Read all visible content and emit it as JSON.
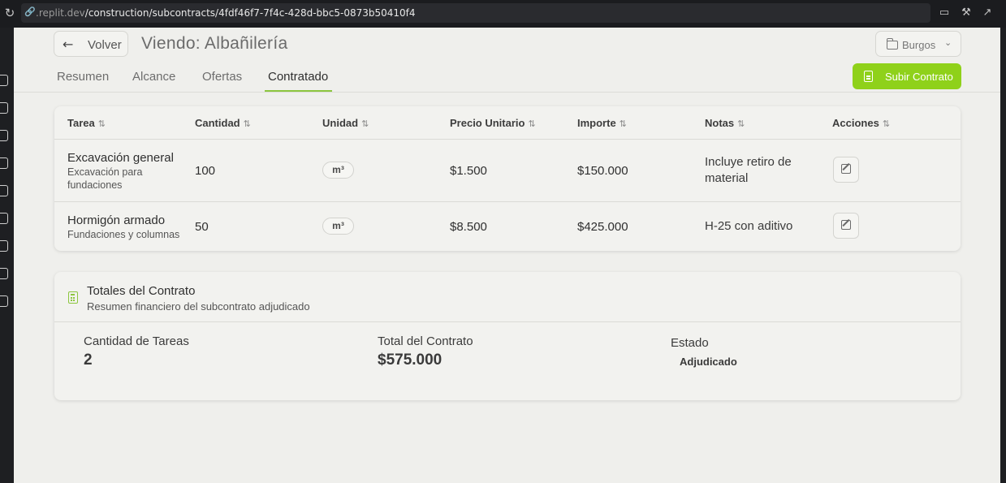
{
  "browser": {
    "url_prefix": ".replit.dev",
    "url_path": "/construction/subcontracts/4fdf46f7-7f4c-428d-bbc5-0873b50410f4"
  },
  "header": {
    "back_label": "Volver",
    "title": "Viendo: Albañilería",
    "city": "Burgos",
    "upload_label": "Subir Contrato"
  },
  "tabs": [
    {
      "label": "Resumen"
    },
    {
      "label": "Alcance"
    },
    {
      "label": "Ofertas"
    },
    {
      "label": "Contratado"
    }
  ],
  "table": {
    "headers": [
      "Tarea",
      "Cantidad",
      "Unidad",
      "Precio Unitario",
      "Importe",
      "Notas",
      "Acciones"
    ],
    "rows": [
      {
        "task": "Excavación general",
        "task_sub": "Excavación para fundaciones",
        "qty": "100",
        "unit": "m³",
        "unit_price": "$1.500",
        "amount": "$150.000",
        "notes": "Incluye retiro de material"
      },
      {
        "task": "Hormigón armado",
        "task_sub": "Fundaciones y columnas",
        "qty": "50",
        "unit": "m³",
        "unit_price": "$8.500",
        "amount": "$425.000",
        "notes": "H-25 con aditivo"
      }
    ]
  },
  "totals": {
    "title": "Totales del Contrato",
    "subtitle": "Resumen financiero del subcontrato adjudicado",
    "task_count_label": "Cantidad de Tareas",
    "task_count": "2",
    "total_label": "Total del Contrato",
    "total": "$575.000",
    "status_label": "Estado",
    "status": "Adjudicado"
  },
  "colors": {
    "accent": "#8fd11a",
    "background": "#efefec",
    "card": "#f2f2ef"
  }
}
